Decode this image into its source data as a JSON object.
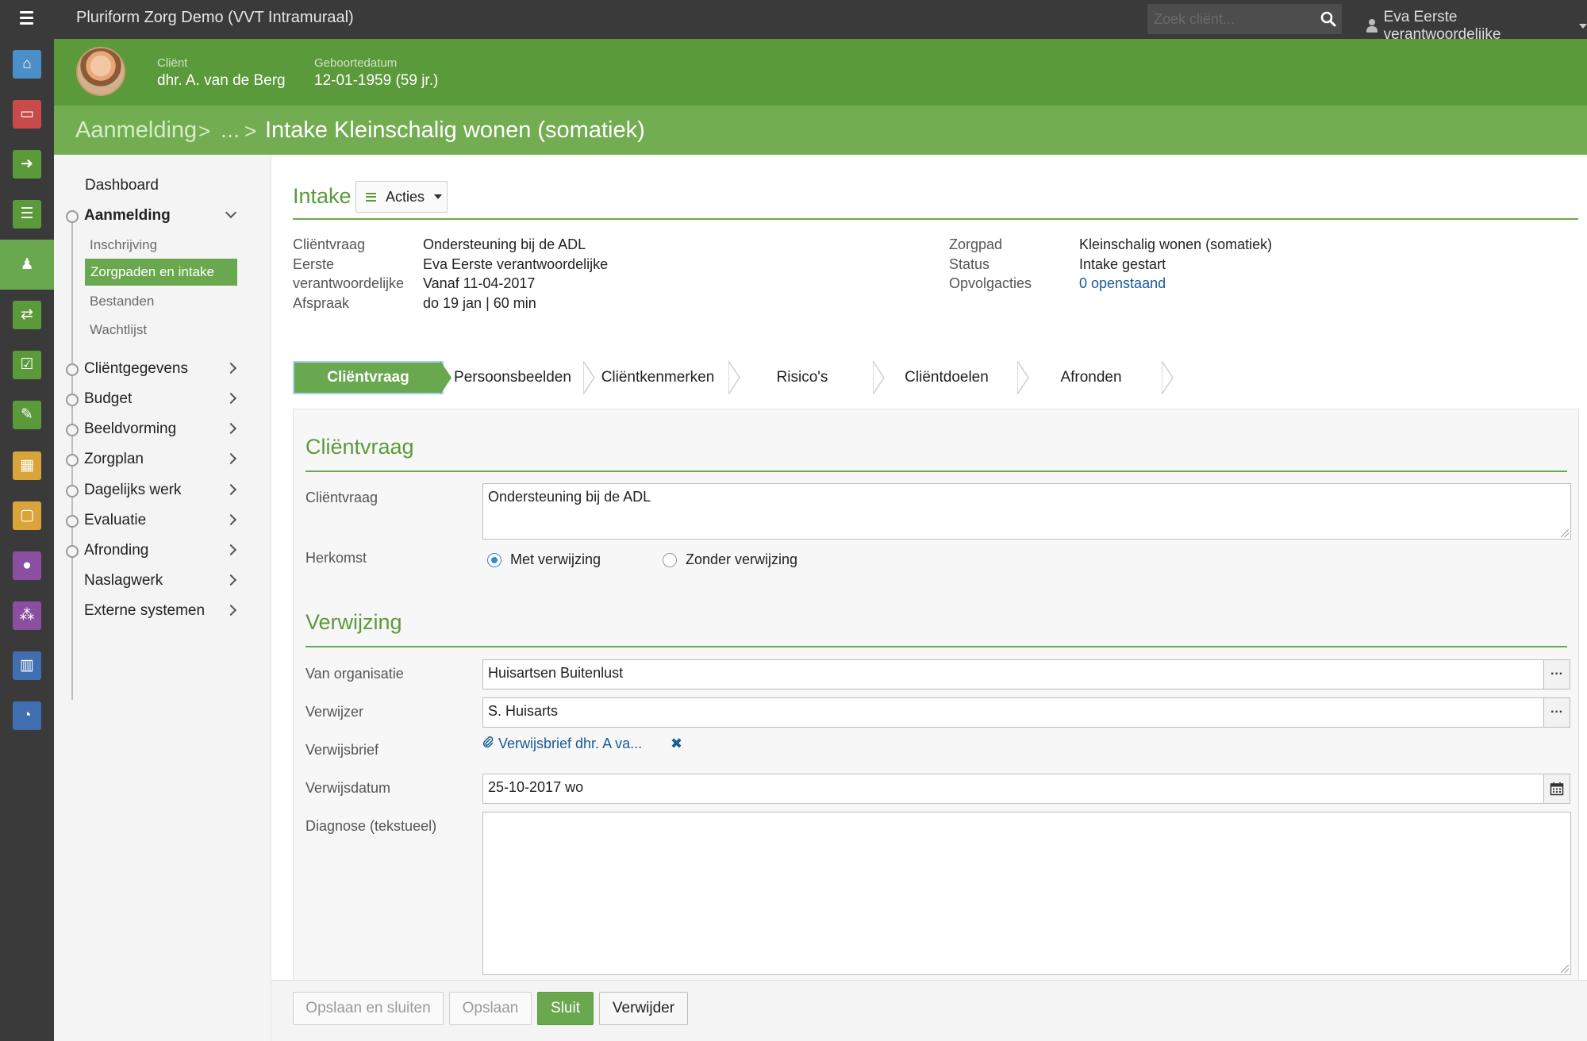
{
  "topbar": {
    "app_title": "Pluriform Zorg Demo  (VVT Intramuraal)",
    "search_placeholder": "Zoek cliënt...",
    "user_name": "Eva Eerste verantwoordelijke"
  },
  "rail": {
    "items": [
      {
        "name": "home-icon",
        "glyph": "⌂",
        "color": "#4a8fc7"
      },
      {
        "name": "inbox-icon",
        "glyph": "▭",
        "color": "#c94a4a"
      },
      {
        "name": "sign-in-icon",
        "glyph": "➜",
        "color": "#5b9a3a"
      },
      {
        "name": "list-icon",
        "glyph": "☰",
        "color": "#5b9a3a"
      },
      {
        "name": "person-icon",
        "glyph": "♟",
        "color": "#6aa84f"
      },
      {
        "name": "shuffle-icon",
        "glyph": "⇄",
        "color": "#5b9a3a"
      },
      {
        "name": "calendar-check-icon",
        "glyph": "☑",
        "color": "#5b9a3a"
      },
      {
        "name": "pencil-icon",
        "glyph": "✎",
        "color": "#5b9a3a"
      },
      {
        "name": "calendar-grid-icon",
        "glyph": "▦",
        "color": "#d9a53a"
      },
      {
        "name": "calendar-icon",
        "glyph": "▢",
        "color": "#d9a53a"
      },
      {
        "name": "user-icon",
        "glyph": "●",
        "color": "#8a4fa0"
      },
      {
        "name": "group-icon",
        "glyph": "⁂",
        "color": "#8a4fa0"
      },
      {
        "name": "bar-chart-icon",
        "glyph": "▥",
        "color": "#3f6fb0"
      },
      {
        "name": "dashboard-icon",
        "glyph": "◔",
        "color": "#3f6fb0"
      }
    ]
  },
  "client": {
    "client_label": "Cliënt",
    "client_name": "dhr. A. van de Berg",
    "dob_label": "Geboortedatum",
    "dob_value": "12-01-1959 (59 jr.)"
  },
  "breadcrumb": {
    "root": "Aanmelding",
    "sep": ">",
    "ellipsis": "...",
    "current": "Intake Kleinschalig wonen (somatiek)"
  },
  "nav": {
    "dashboard": "Dashboard",
    "aanmelding": "Aanmelding",
    "sub": [
      "Inschrijving",
      "Zorgpaden en intake",
      "Bestanden",
      "Wachtlijst"
    ],
    "sections": [
      "Cliëntgegevens",
      "Budget",
      "Beeldvorming",
      "Zorgplan",
      "Dagelijks werk",
      "Evaluatie",
      "Afronding",
      "Naslagwerk",
      "Externe systemen"
    ]
  },
  "main": {
    "title": "Intake",
    "acties_label": "Acties",
    "info_left": [
      {
        "label": "Cliëntvraag",
        "value": "Ondersteuning bij de ADL"
      },
      {
        "label": "Eerste",
        "value": "Eva Eerste verantwoordelijke"
      },
      {
        "label": "verantwoordelijke",
        "value": "Vanaf 11-04-2017"
      },
      {
        "label": "Afspraak",
        "value": "do 19 jan | 60 min"
      }
    ],
    "info_right": [
      {
        "label": "Zorgpad",
        "value": "Kleinschalig wonen (somatiek)"
      },
      {
        "label": "Status",
        "value": "Intake gestart"
      },
      {
        "label": "Opvolgacties",
        "value": "0 openstaand"
      }
    ],
    "steps": [
      "Cliëntvraag",
      "Persoonsbeelden",
      "Cliëntkenmerken",
      "Risico's",
      "Cliëntdoelen",
      "Afronden"
    ],
    "active_step": "Cliëntvraag"
  },
  "form": {
    "section1_title": "Cliëntvraag",
    "clientvraag_label": "Cliëntvraag",
    "clientvraag_value": "Ondersteuning bij de ADL",
    "herkomst_label": "Herkomst",
    "radio_met": "Met verwijzing",
    "radio_zonder": "Zonder verwijzing",
    "herkomst_selected": "Met verwijzing",
    "section2_title": "Verwijzing",
    "van_org_label": "Van organisatie",
    "van_org_value": "Huisartsen Buitenlust",
    "verwijzer_label": "Verwijzer",
    "verwijzer_value": "S. Huisarts",
    "verwijsbrief_label": "Verwijsbrief",
    "verwijsbrief_link": "Verwijsbrief dhr. A va...",
    "verwijsdatum_label": "Verwijsdatum",
    "verwijsdatum_value": "25-10-2017 wo",
    "diagnose_label": "Diagnose (tekstueel)",
    "diagnose_value": "",
    "ellipsis_btn": "···"
  },
  "footer": {
    "save_close": "Opslaan en sluiten",
    "save": "Opslaan",
    "close": "Sluit",
    "delete": "Verwijder"
  }
}
